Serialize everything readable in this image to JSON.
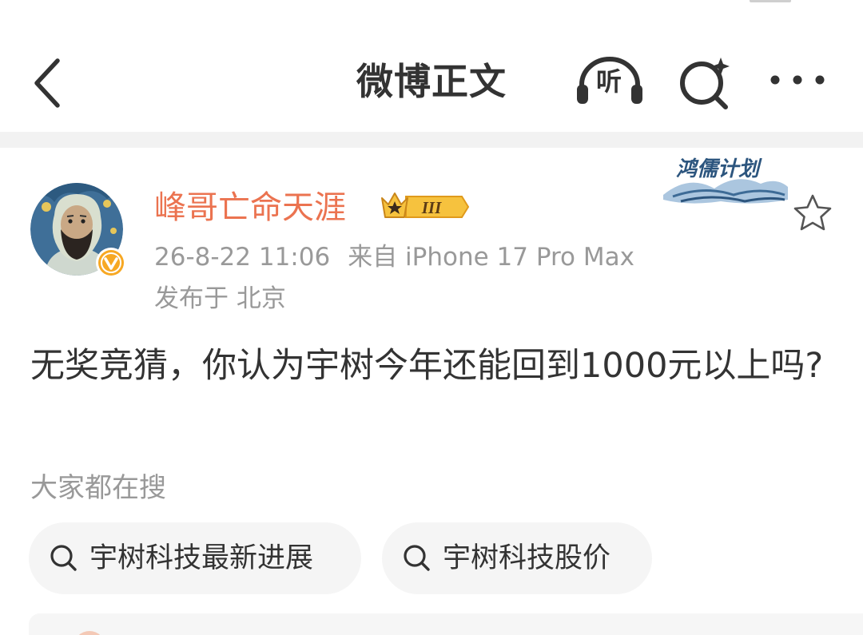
{
  "nav": {
    "title": "微博正文",
    "listen_label": "听",
    "back_icon": "chevron-left-icon",
    "listen_icon": "headphones-icon",
    "search_icon": "search-sparkle-icon",
    "more_icon": "more-horizontal-icon"
  },
  "author": {
    "name": "峰哥亡命天涯",
    "vip_level": "III",
    "verified_icon": "verified-v-icon",
    "avatar_icon": "avatar-bearded-man",
    "name_color": "#eb7350"
  },
  "meta": {
    "timestamp": "26-8-22 11:06",
    "source": "来自 iPhone 17 Pro Max",
    "location": "发布于 北京"
  },
  "campaign": {
    "label": "鸿儒计划"
  },
  "post": {
    "text": "无奖竞猜，你认为宇树今年还能回到1000元以上吗?"
  },
  "trending": {
    "title": "大家都在搜",
    "chips": [
      {
        "label": "宇树科技最新进展",
        "icon": "search-icon"
      },
      {
        "label": "宇树科技股价",
        "icon": "search-icon"
      }
    ]
  },
  "colors": {
    "accent_orange": "#eb7350",
    "text_primary": "#333333",
    "text_secondary": "#999999",
    "chip_background": "#f5f5f5",
    "divider": "#f2f2f2"
  }
}
